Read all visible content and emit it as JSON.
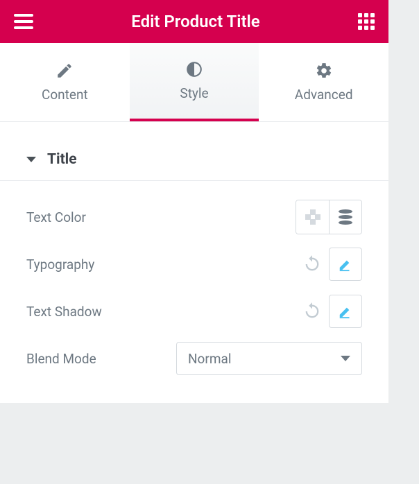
{
  "header": {
    "title": "Edit Product Title"
  },
  "tabs": {
    "content": {
      "label": "Content"
    },
    "style": {
      "label": "Style"
    },
    "advanced": {
      "label": "Advanced"
    }
  },
  "section": {
    "title": "Title"
  },
  "controls": {
    "text_color": {
      "label": "Text Color"
    },
    "typography": {
      "label": "Typography"
    },
    "text_shadow": {
      "label": "Text Shadow"
    },
    "blend_mode": {
      "label": "Blend Mode",
      "value": "Normal"
    }
  }
}
